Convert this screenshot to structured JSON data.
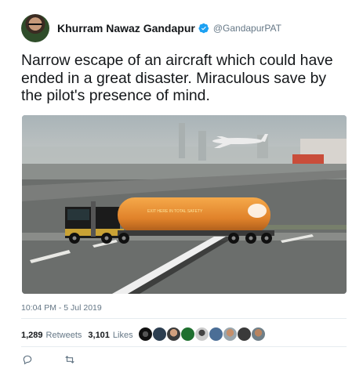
{
  "tweet": {
    "display_name": "Khurram Nawaz Gandapur",
    "handle": "@GandapurPAT",
    "text": "Narrow escape of an aircraft which could have ended in a great disaster. Miraculous save by the pilot's presence of mind.",
    "timestamp": "10:04 PM - 5 Jul 2019",
    "retweets_count": "1,289",
    "retweets_label": "Retweets",
    "likes_count": "3,101",
    "likes_label": "Likes",
    "tanker_text": "EXIT HERE IN TOTAL SAFETY"
  },
  "colors": {
    "verified": "#1da1f2",
    "secondary_text": "#657786",
    "tanker_orange": "#e98a2c"
  },
  "icons": {
    "verified": "verified-badge-icon",
    "reply": "reply-icon",
    "retweet": "retweet-icon"
  }
}
